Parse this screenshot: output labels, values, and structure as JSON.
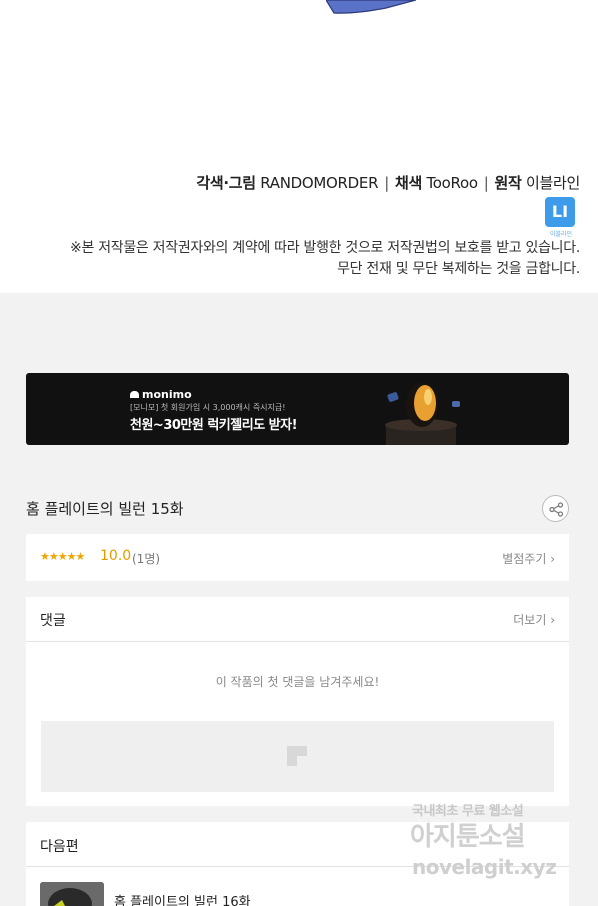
{
  "credits": {
    "role1": "각색·그림",
    "name1": "RANDOMORDER",
    "role2": "채색",
    "name2": "TooRoo",
    "role3": "원작",
    "name3": "이블라인",
    "separator": "|",
    "logo_text": "LI",
    "logo_sub": "이블라인"
  },
  "copyright": {
    "line1": "※본 저작물은 저작권자와의 계약에 따라 발행한 것으로 저작권법의 보호를 받고 있습니다.",
    "line2": "무단 전재 및 무단 복제하는 것을 금합니다."
  },
  "banner": {
    "brand": "monimo",
    "sub": "[모니모] 첫 회원가입 시 3,000캐시 즉시지급!",
    "main": "천원~30만원 럭키젤리도 받자!"
  },
  "episode": {
    "title": "홈 플레이트의 빌런 15화"
  },
  "rating": {
    "stars": "★★★★★",
    "score": "10.0",
    "count": "(1명)",
    "rate_link": "별점주기 ›"
  },
  "comments": {
    "title": "댓글",
    "more": "더보기 ›",
    "empty": "이 작품의 첫 댓글을 남겨주세요!"
  },
  "next": {
    "title": "다음편",
    "episode": "홈 플레이트의 빌런 16화"
  },
  "watermark": {
    "line1": "국내최초 무료 웹소설",
    "line2": "아지툰소설",
    "line3": "novelagit.xyz"
  }
}
